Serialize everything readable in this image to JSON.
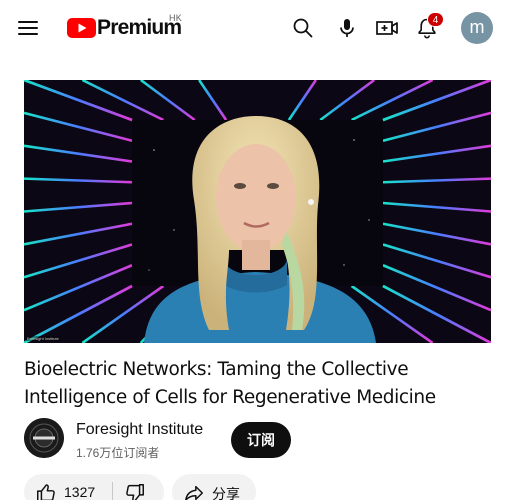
{
  "header": {
    "brand": "Premium",
    "region": "HK",
    "notification_count": "4",
    "avatar_letter": "m"
  },
  "icons": {
    "menu": "hamburger-icon",
    "logo": "youtube-play-icon",
    "search": "search-icon",
    "voice": "microphone-icon",
    "create": "create-video-icon",
    "notifications": "bell-icon",
    "like": "thumbs-up-icon",
    "dislike": "thumbs-down-icon",
    "share": "share-arrow-icon"
  },
  "video": {
    "title": "Bioelectric Networks: Taming the Collective Intelligence of Cells for Regenerative Medicine",
    "watermark": "Foresight Institute"
  },
  "channel": {
    "name": "Foresight Institute",
    "subscribers": "1.76万位订阅者",
    "subscribe_label": "订阅"
  },
  "actions": {
    "like_count": "1327",
    "share_label": "分享"
  },
  "colors": {
    "brand_red": "#ff0000",
    "badge_red": "#cc0000",
    "avatar_bg": "#7694a4",
    "pill_bg": "#f2f2f2",
    "subscribe_bg": "#0f0f0f"
  }
}
